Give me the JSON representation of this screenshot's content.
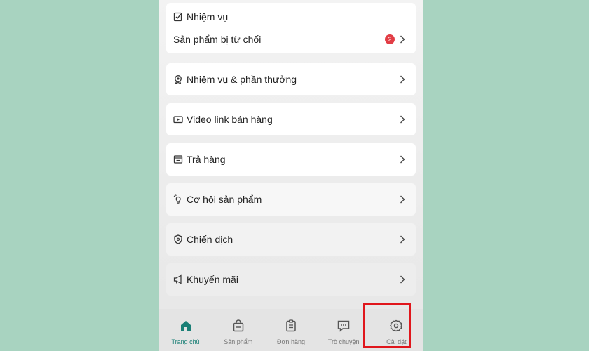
{
  "tasks_card": {
    "header": "Nhiệm vụ",
    "item_label": "Sản phẩm bị từ chối",
    "badge": "2"
  },
  "menu": [
    {
      "label": "Nhiệm vụ & phần thưởng",
      "icon": "reward-icon"
    },
    {
      "label": "Video link bán hàng",
      "icon": "video-icon"
    },
    {
      "label": "Trả hàng",
      "icon": "return-box-icon"
    },
    {
      "label": "Cơ hội sản phẩm",
      "icon": "lightbulb-icon"
    },
    {
      "label": "Chiến dịch",
      "icon": "shield-icon"
    },
    {
      "label": "Khuyến mãi",
      "icon": "megaphone-icon"
    }
  ],
  "tabs": [
    {
      "label": "Trang chủ",
      "icon": "home-icon",
      "active": true
    },
    {
      "label": "Sản phẩm",
      "icon": "bag-icon",
      "active": false
    },
    {
      "label": "Đơn hàng",
      "icon": "clipboard-icon",
      "active": false
    },
    {
      "label": "Trò chuyện",
      "icon": "chat-icon",
      "active": false
    },
    {
      "label": "Cài đặt",
      "icon": "gear-icon",
      "active": false
    }
  ],
  "colors": {
    "background": "#a8d3c0",
    "accent": "#1a7f76",
    "badge": "#e23d45",
    "highlight": "#e0161c"
  }
}
